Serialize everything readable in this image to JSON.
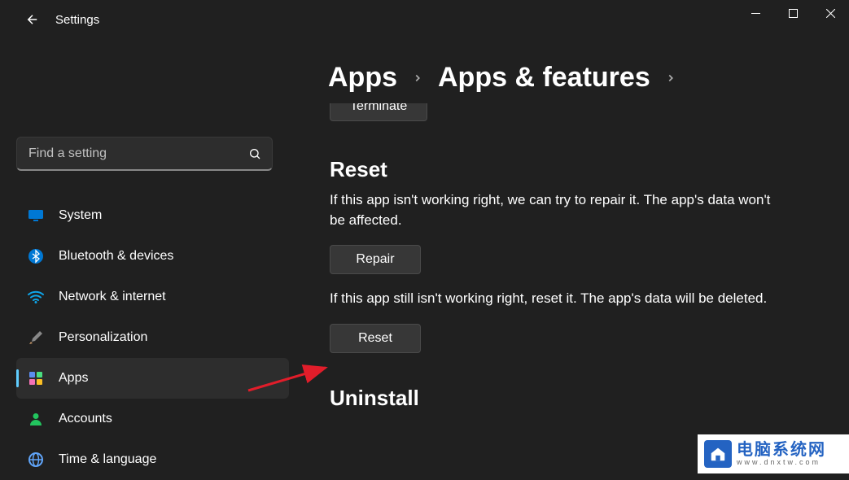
{
  "titlebar": {
    "app_title": "Settings"
  },
  "search": {
    "placeholder": "Find a setting"
  },
  "sidebar": {
    "items": [
      {
        "label": "System",
        "icon": "monitor-icon"
      },
      {
        "label": "Bluetooth & devices",
        "icon": "bluetooth-icon"
      },
      {
        "label": "Network & internet",
        "icon": "wifi-icon"
      },
      {
        "label": "Personalization",
        "icon": "brush-icon"
      },
      {
        "label": "Apps",
        "icon": "apps-icon"
      },
      {
        "label": "Accounts",
        "icon": "account-icon"
      },
      {
        "label": "Time & language",
        "icon": "globe-icon"
      }
    ]
  },
  "breadcrumb": {
    "root": "Apps",
    "page": "Apps & features"
  },
  "content": {
    "terminate_label": "Terminate",
    "reset_heading": "Reset",
    "repair_text": "If this app isn't working right, we can try to repair it. The app's data won't be affected.",
    "repair_label": "Repair",
    "reset_text": "If this app still isn't working right, reset it. The app's data will be deleted.",
    "reset_label": "Reset",
    "uninstall_heading": "Uninstall"
  },
  "watermark": {
    "cn_text": "电脑系统网",
    "url_text": "www.dnxtw.com"
  }
}
